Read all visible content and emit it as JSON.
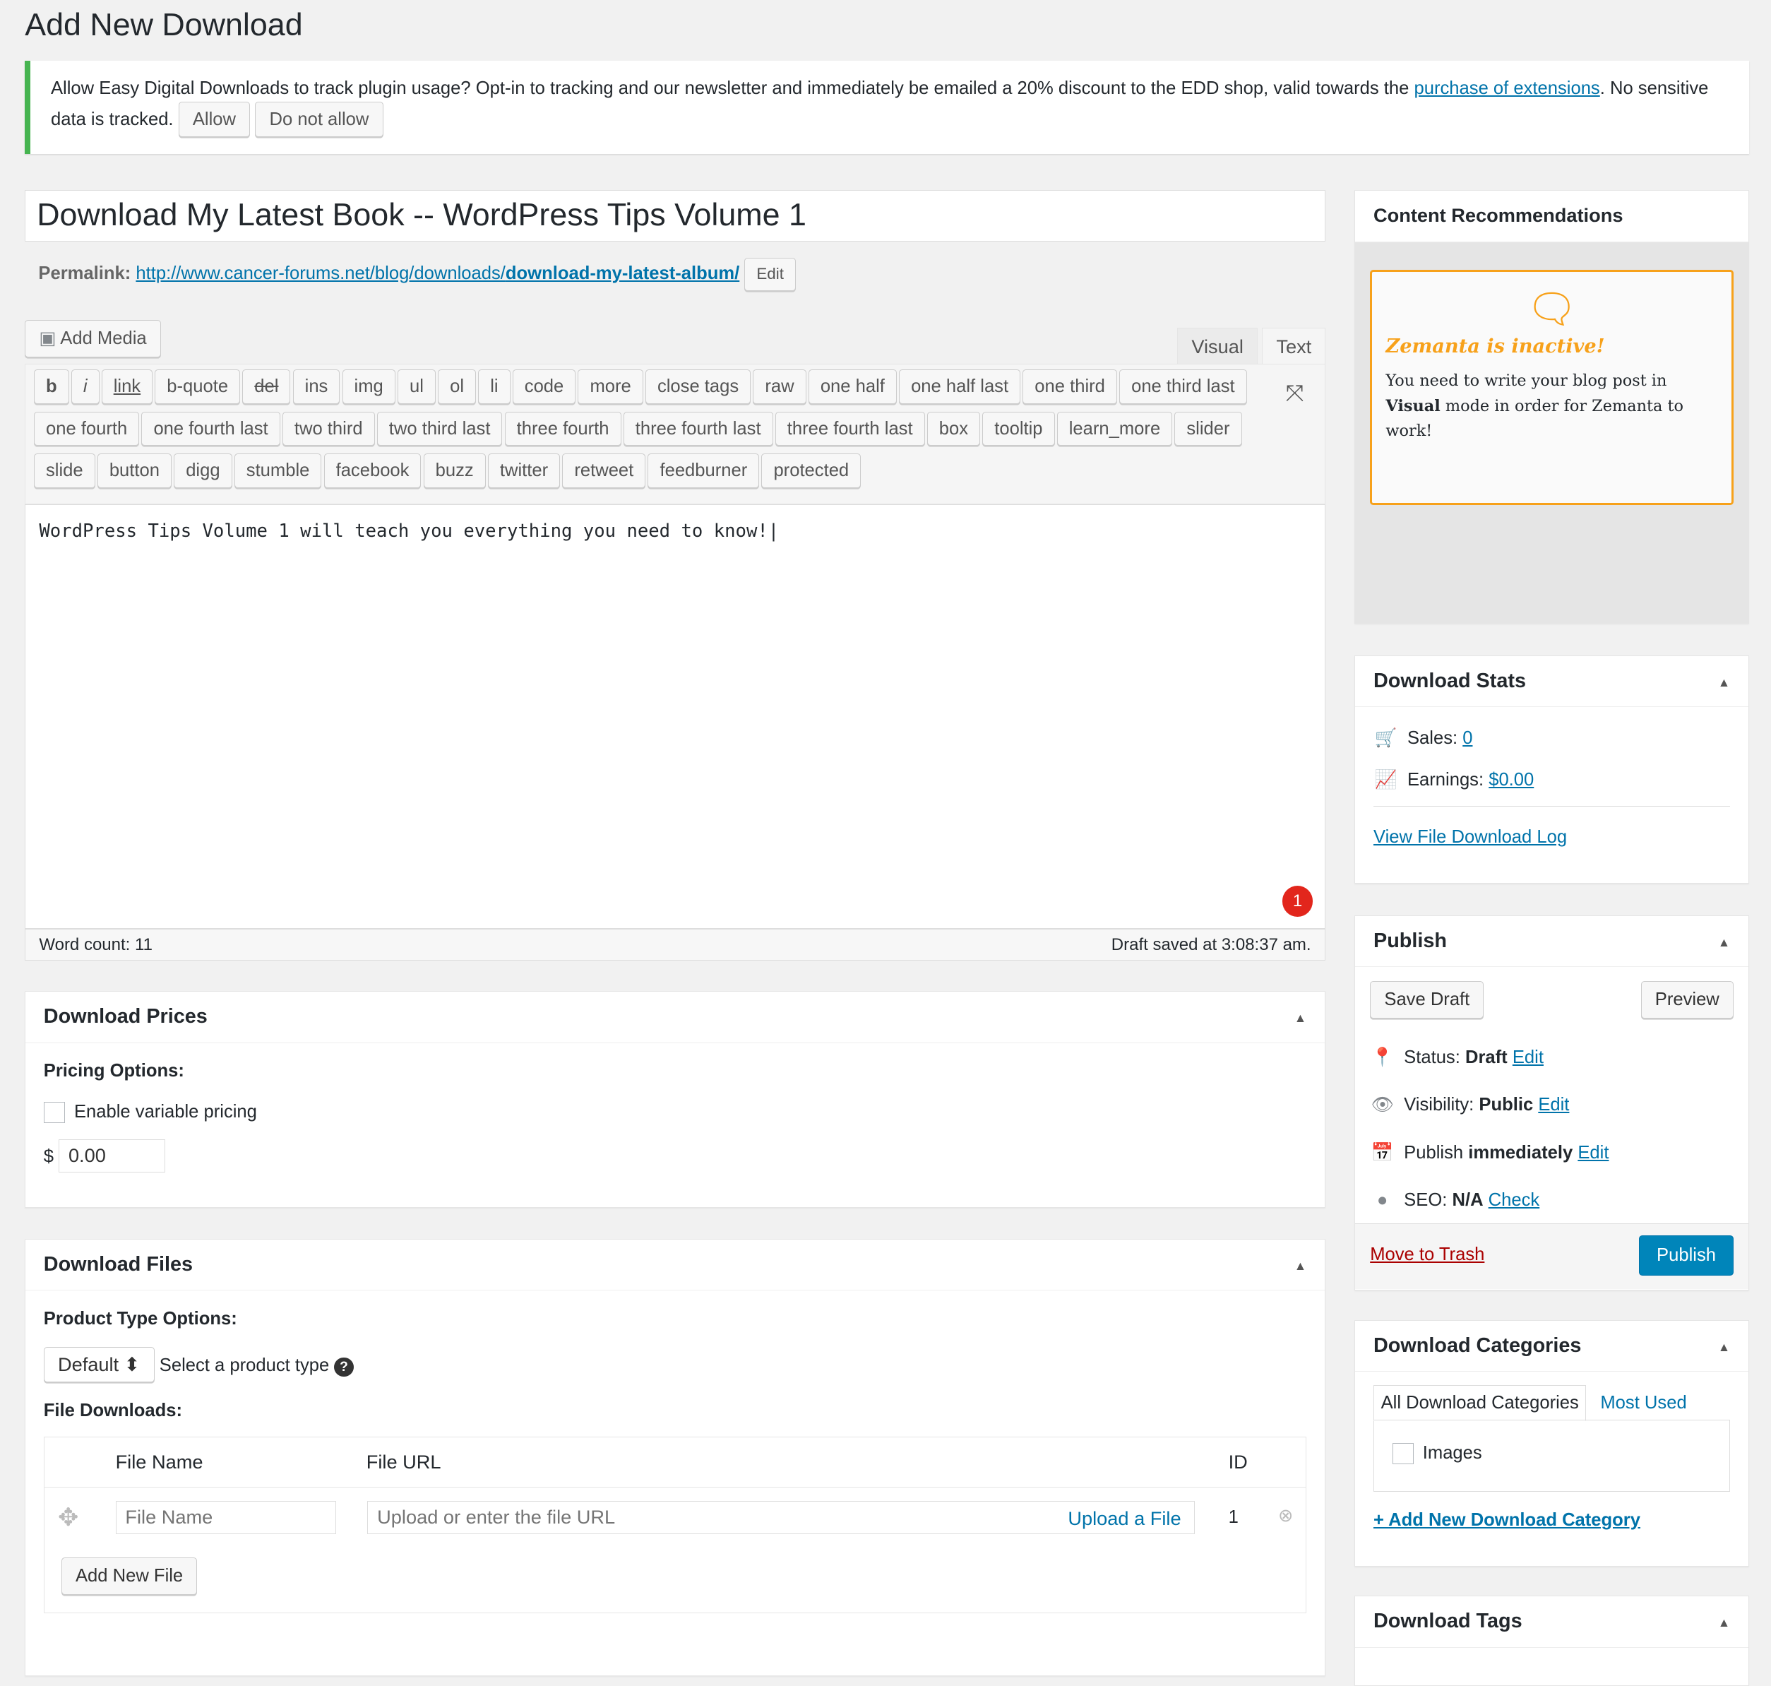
{
  "page": {
    "title": "Add New Download"
  },
  "notice": {
    "text": "Allow Easy Digital Downloads to track plugin usage? Opt-in to tracking and our newsletter and immediately be emailed a 20% discount to the EDD shop, valid towards the",
    "link": "purchase of extensions",
    "text2": ". No sensitive data is tracked.",
    "allow": "Allow",
    "deny": "Do not allow",
    "accent": "#46b450"
  },
  "post": {
    "title": "Download My Latest Book -- WordPress Tips Volume 1",
    "permalink_label": "Permalink:",
    "permalink_base": "http://www.cancer-forums.net/blog/downloads/",
    "permalink_slug": "download-my-latest-album/",
    "edit": "Edit"
  },
  "editor": {
    "add_media": "Add Media",
    "tab_visual": "Visual",
    "tab_text": "Text",
    "content": "WordPress Tips Volume 1 will teach you everything you need to know!",
    "word_count": "Word count: 11",
    "draft_saved": "Draft saved at 3:08:37 am.",
    "badge": "1",
    "buttons": [
      "b",
      "i",
      "link",
      "b-quote",
      "del",
      "ins",
      "img",
      "ul",
      "ol",
      "li",
      "code",
      "more",
      "close tags",
      "raw",
      "one half",
      "one half last",
      "one third",
      "one third last",
      "one fourth",
      "one fourth last",
      "two third",
      "two third last",
      "three fourth",
      "three fourth last",
      "three fourth last",
      "box",
      "tooltip",
      "learn_more",
      "slider",
      "slide",
      "button",
      "digg",
      "stumble",
      "facebook",
      "buzz",
      "twitter",
      "retweet",
      "feedburner",
      "protected"
    ]
  },
  "prices": {
    "title": "Download Prices",
    "pricing_options": "Pricing Options:",
    "variable": "Enable variable pricing",
    "currency": "$",
    "price": "0.00"
  },
  "files": {
    "title": "Download Files",
    "product_type_label": "Product Type Options:",
    "product_type": "Default",
    "product_type_hint": "Select a product type",
    "file_downloads": "File Downloads:",
    "col_name": "File Name",
    "col_url": "File URL",
    "col_id": "ID",
    "name_placeholder": "File Name",
    "url_placeholder": "Upload or enter the file URL",
    "upload": "Upload a File",
    "id": "1",
    "add_new": "Add New File"
  },
  "zemanta": {
    "title": "Content Recommendations",
    "heading": "Zemanta is inactive!",
    "msg1": "You need to write your blog post in",
    "msg_bold": "Visual",
    "msg2": "mode in order for Zemanta to work!",
    "accent": "#f7a11a"
  },
  "stats": {
    "title": "Download Stats",
    "sales_label": "Sales:",
    "sales": "0",
    "earnings_label": "Earnings:",
    "earnings": "$0.00",
    "log": "View File Download Log"
  },
  "publish": {
    "title": "Publish",
    "save_draft": "Save Draft",
    "preview": "Preview",
    "status_label": "Status:",
    "status": "Draft",
    "visibility_label": "Visibility:",
    "visibility": "Public",
    "publish_label": "Publish",
    "publish_when": "immediately",
    "seo_label": "SEO:",
    "seo": "N/A",
    "check": "Check",
    "edit": "Edit",
    "trash": "Move to Trash",
    "publish_btn": "Publish"
  },
  "categories": {
    "title": "Download Categories",
    "tab_all": "All Download Categories",
    "tab_most": "Most Used",
    "items": [
      "Images"
    ],
    "add": "+ Add New Download Category"
  },
  "tags": {
    "title": "Download Tags"
  }
}
